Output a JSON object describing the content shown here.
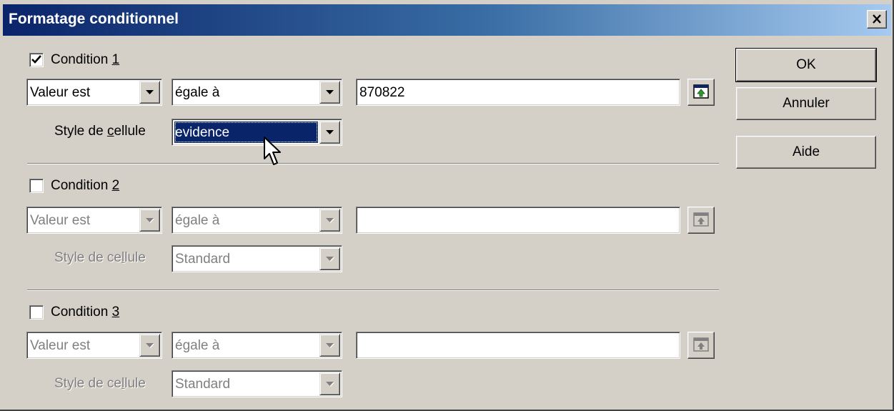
{
  "window": {
    "title": "Formatage conditionnel"
  },
  "conditions": [
    {
      "checked": true,
      "label_prefix": "Condition ",
      "label_accel": "1",
      "value_type": "Valeur est",
      "operator": "égale à",
      "value": "870822",
      "style_label_a": "Style de ",
      "style_label_accel": "c",
      "style_label_b": "ellule",
      "style": "evidence",
      "enabled": true
    },
    {
      "checked": false,
      "label_prefix": "Condition ",
      "label_accel": "2",
      "value_type": "Valeur est",
      "operator": "égale à",
      "value": "",
      "style_label_a": "Style de ce",
      "style_label_accel": "l",
      "style_label_b": "lule",
      "style": "Standard",
      "enabled": false
    },
    {
      "checked": false,
      "label_prefix": "Condition ",
      "label_accel": "3",
      "value_type": "Valeur est",
      "operator": "égale à",
      "value": "",
      "style_label_a": "Style de ce",
      "style_label_accel": "l",
      "style_label_b": "lule",
      "style": "Standard",
      "enabled": false
    }
  ],
  "buttons": {
    "ok": "OK",
    "cancel": "Annuler",
    "help": "Aide"
  },
  "icons": {
    "close": "close-icon",
    "check": "checkmark-icon",
    "dropdown": "chevron-down-icon",
    "shrink": "shrink-dialog-icon",
    "cursor": "mouse-pointer-icon"
  },
  "colors": {
    "title_start": "#0a246a",
    "title_end": "#a6caf0",
    "face": "#d4d0c8",
    "selection": "#0a246a"
  }
}
